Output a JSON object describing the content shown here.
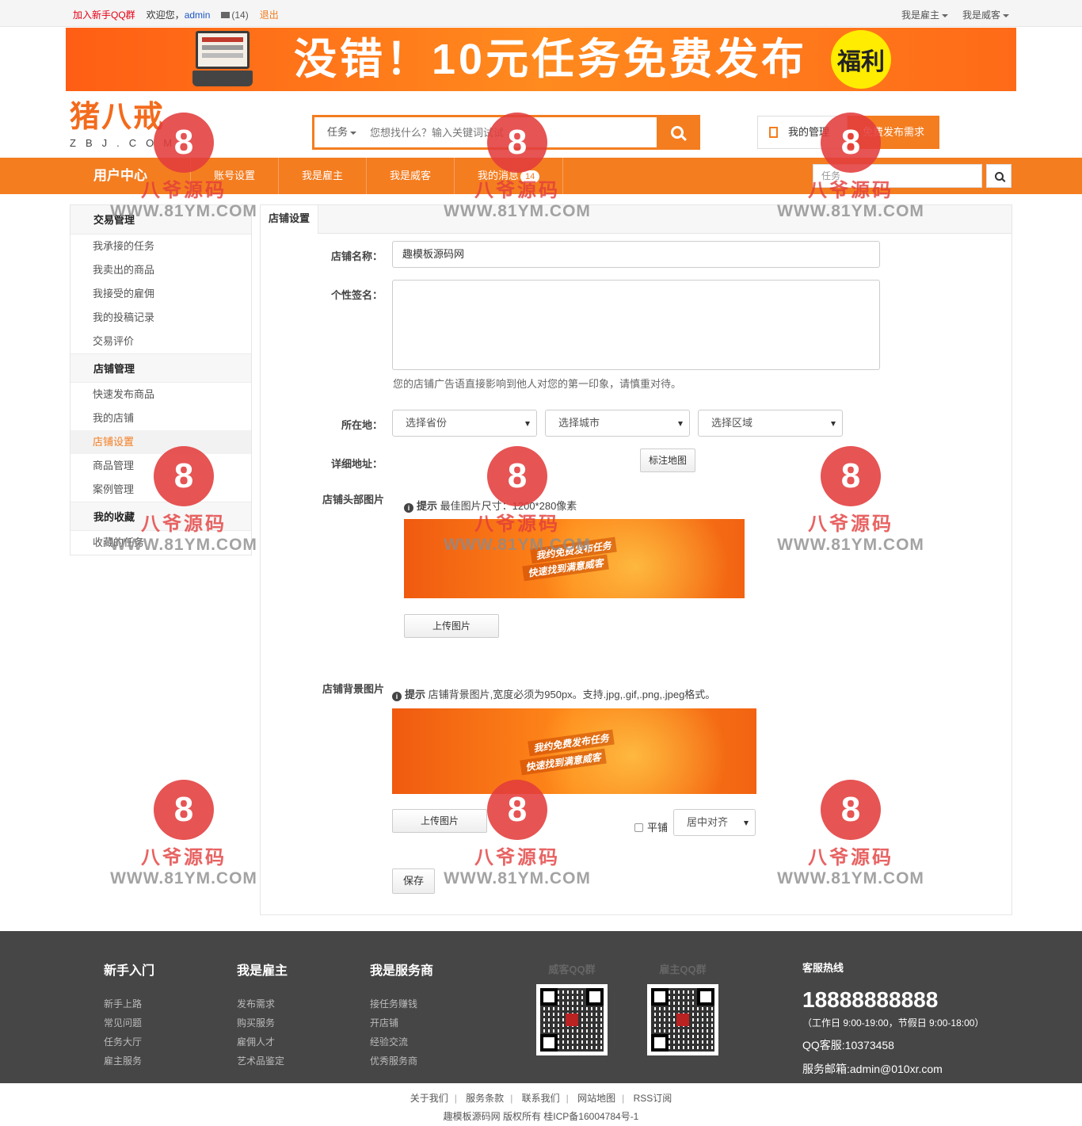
{
  "topbar": {
    "qq_group": "加入新手QQ群",
    "welcome": "欢迎您，",
    "username": "admin",
    "messages": "(14)",
    "logout": "退出",
    "employer_menu": "我是雇主",
    "witkey_menu": "我是威客"
  },
  "banner": {
    "slogan": "没错！10元任务免费发布",
    "badge": "福利"
  },
  "header": {
    "logo_cn": "猪八戒",
    "logo_en": "ZBJ.COM",
    "search_type": "任务",
    "search_placeholder": "您想找什么？输入关键词试试",
    "manage_button": "我的管理",
    "post_button": "免费发布需求"
  },
  "nav": {
    "title": "用户中心",
    "items": [
      "账号设置",
      "我是雇主",
      "我是威客",
      "我的消息"
    ],
    "message_badge": "14",
    "search_placeholder": "任务"
  },
  "sidebar": {
    "groups": [
      {
        "title": "交易管理",
        "items": [
          "我承接的任务",
          "我卖出的商品",
          "我接受的雇佣",
          "我的投稿记录",
          "交易评价"
        ]
      },
      {
        "title": "店铺管理",
        "items": [
          "快速发布商品",
          "我的店铺",
          "店铺设置",
          "商品管理",
          "案例管理"
        ]
      },
      {
        "title": "我的收藏",
        "items": [
          "收藏的任务"
        ]
      }
    ],
    "active": "店铺设置"
  },
  "form": {
    "tab": "店铺设置",
    "shop_name_label": "店铺名称：",
    "shop_name_value": "趣模板源码网",
    "signature_label": "个性签名：",
    "signature_hint": "您的店铺广告语直接影响到他人对您的第一印象，请慎重对待。",
    "location_label": "所在地：",
    "province": "选择省份",
    "city": "选择城市",
    "district": "选择区域",
    "address_label": "详细地址：",
    "map_button": "标注地图",
    "header_img_label": "店铺头部图片",
    "header_hint_tag": "提示",
    "header_hint": "最佳图片尺寸：1200*280像素",
    "promo_line1": "我约免费发布任务",
    "promo_line2": "快速找到满意威客",
    "upload_button": "上传图片",
    "bg_img_label": "店铺背景图片",
    "bg_hint_tag": "提示",
    "bg_hint": "店铺背景图片,宽度必须为950px。支持.jpg,.gif,.png,.jpeg格式。",
    "tile_label": "平铺",
    "align_option": "居中对齐",
    "save_button": "保存"
  },
  "footer": {
    "columns": [
      {
        "title": "新手入门",
        "items": [
          "新手上路",
          "常见问题",
          "任务大厅",
          "雇主服务"
        ]
      },
      {
        "title": "我是雇主",
        "items": [
          "发布需求",
          "购买服务",
          "雇佣人才",
          "艺术品鉴定"
        ]
      },
      {
        "title": "我是服务商",
        "items": [
          "接任务赚钱",
          "开店铺",
          "经验交流",
          "优秀服务商"
        ]
      }
    ],
    "qr_witkey": "威客QQ群",
    "qr_employer": "雇主QQ群",
    "hotline_title": "客服热线",
    "phone": "18888888888",
    "hours": "（工作日 9:00-19:00，节假日 9:00-18:00）",
    "qq": "QQ客服:10373458",
    "email": "服务邮箱:admin@010xr.com"
  },
  "bottom": {
    "links": [
      "关于我们",
      "服务条款",
      "联系我们",
      "网站地图",
      "RSS订阅"
    ],
    "copyright": "趣模板源码网 版权所有 桂ICP备16004784号-1"
  },
  "watermark": {
    "cn": "八爷源码",
    "url": "WWW.81YM.COM"
  }
}
